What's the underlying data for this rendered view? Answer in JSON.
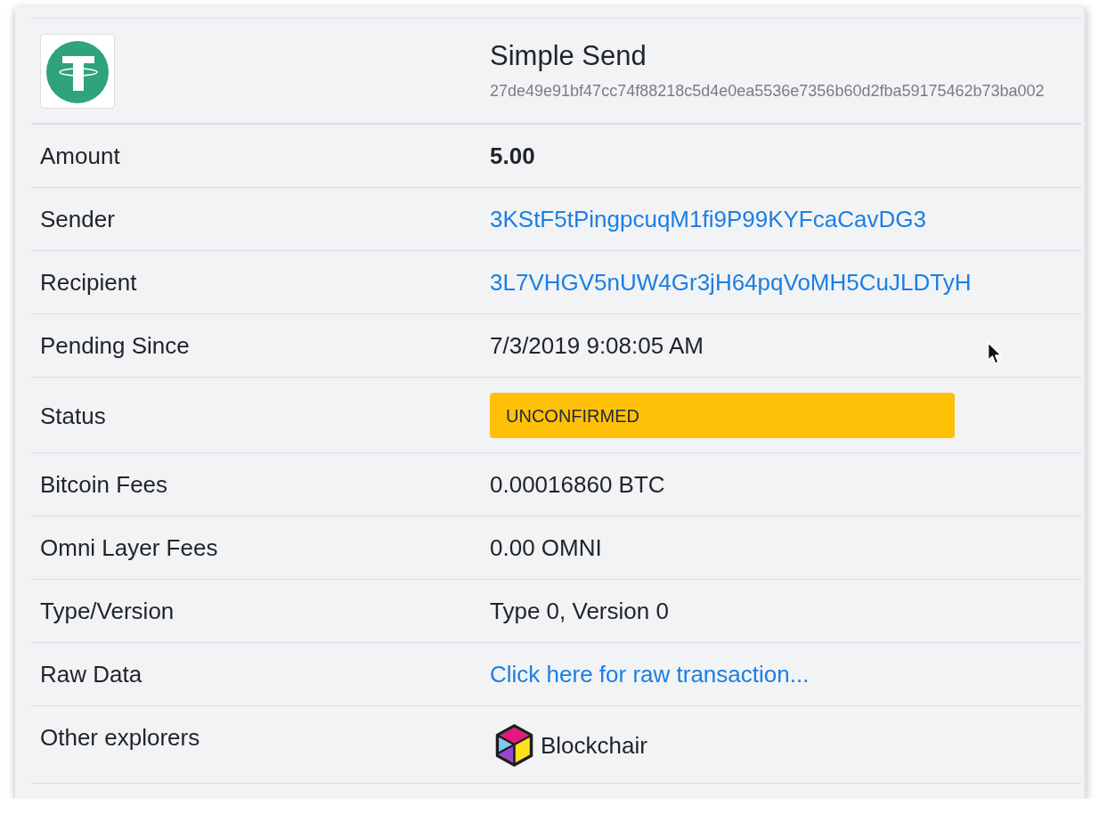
{
  "transaction": {
    "title": "Simple Send",
    "hash": "27de49e91bf47cc74f88218c5d4e0ea5536e7356b60d2fba59175462b73ba002"
  },
  "rows": [
    {
      "label": "Amount",
      "kind": "bold",
      "value": "5.00"
    },
    {
      "label": "Sender",
      "kind": "link",
      "value": "3KStF5tPingpcuqM1fi9P99KYFcaCavDG3"
    },
    {
      "label": "Recipient",
      "kind": "link",
      "value": "3L7VHGV5nUW4Gr3jH64pqVoMH5CuJLDTyH"
    },
    {
      "label": "Pending Since",
      "kind": "text",
      "value": "7/3/2019 9:08:05 AM"
    },
    {
      "label": "Status",
      "kind": "status",
      "value": "UNCONFIRMED"
    },
    {
      "label": "Bitcoin Fees",
      "kind": "text",
      "value": "0.00016860 BTC"
    },
    {
      "label": "Omni Layer Fees",
      "kind": "text",
      "value": "0.00 OMNI"
    },
    {
      "label": "Type/Version",
      "kind": "text",
      "value": "Type 0, Version 0"
    },
    {
      "label": "Raw Data",
      "kind": "link",
      "value": "Click here for raw transaction..."
    },
    {
      "label": "Other explorers",
      "kind": "explorer",
      "value": "Blockchair"
    }
  ]
}
